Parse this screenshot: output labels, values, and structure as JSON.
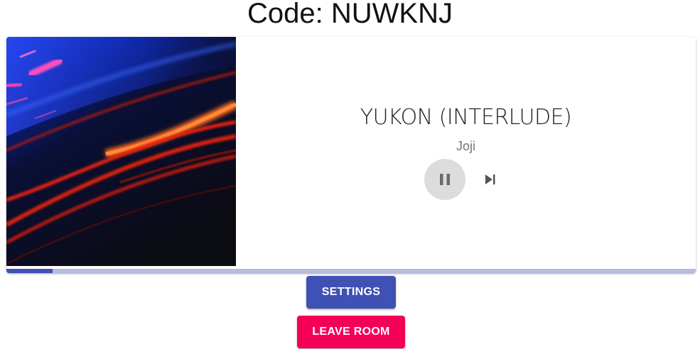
{
  "room": {
    "code_text": "Code: NUWKNJ"
  },
  "player": {
    "title": "YUKON (INTERLUDE)",
    "artist": "Joji",
    "is_playing": true,
    "progress_fraction": 0.067,
    "album_art_icon": "album-cover-image",
    "pause_icon": "pause-icon",
    "skip_icon": "skip-next-icon"
  },
  "buttons": {
    "settings_label": "SETTINGS",
    "leave_label": "LEAVE ROOM"
  },
  "colors": {
    "primary": "#3f51b5",
    "secondary": "#f50057",
    "progress_track": "#b6bcdd",
    "pause_bg": "#dcdcdc"
  }
}
